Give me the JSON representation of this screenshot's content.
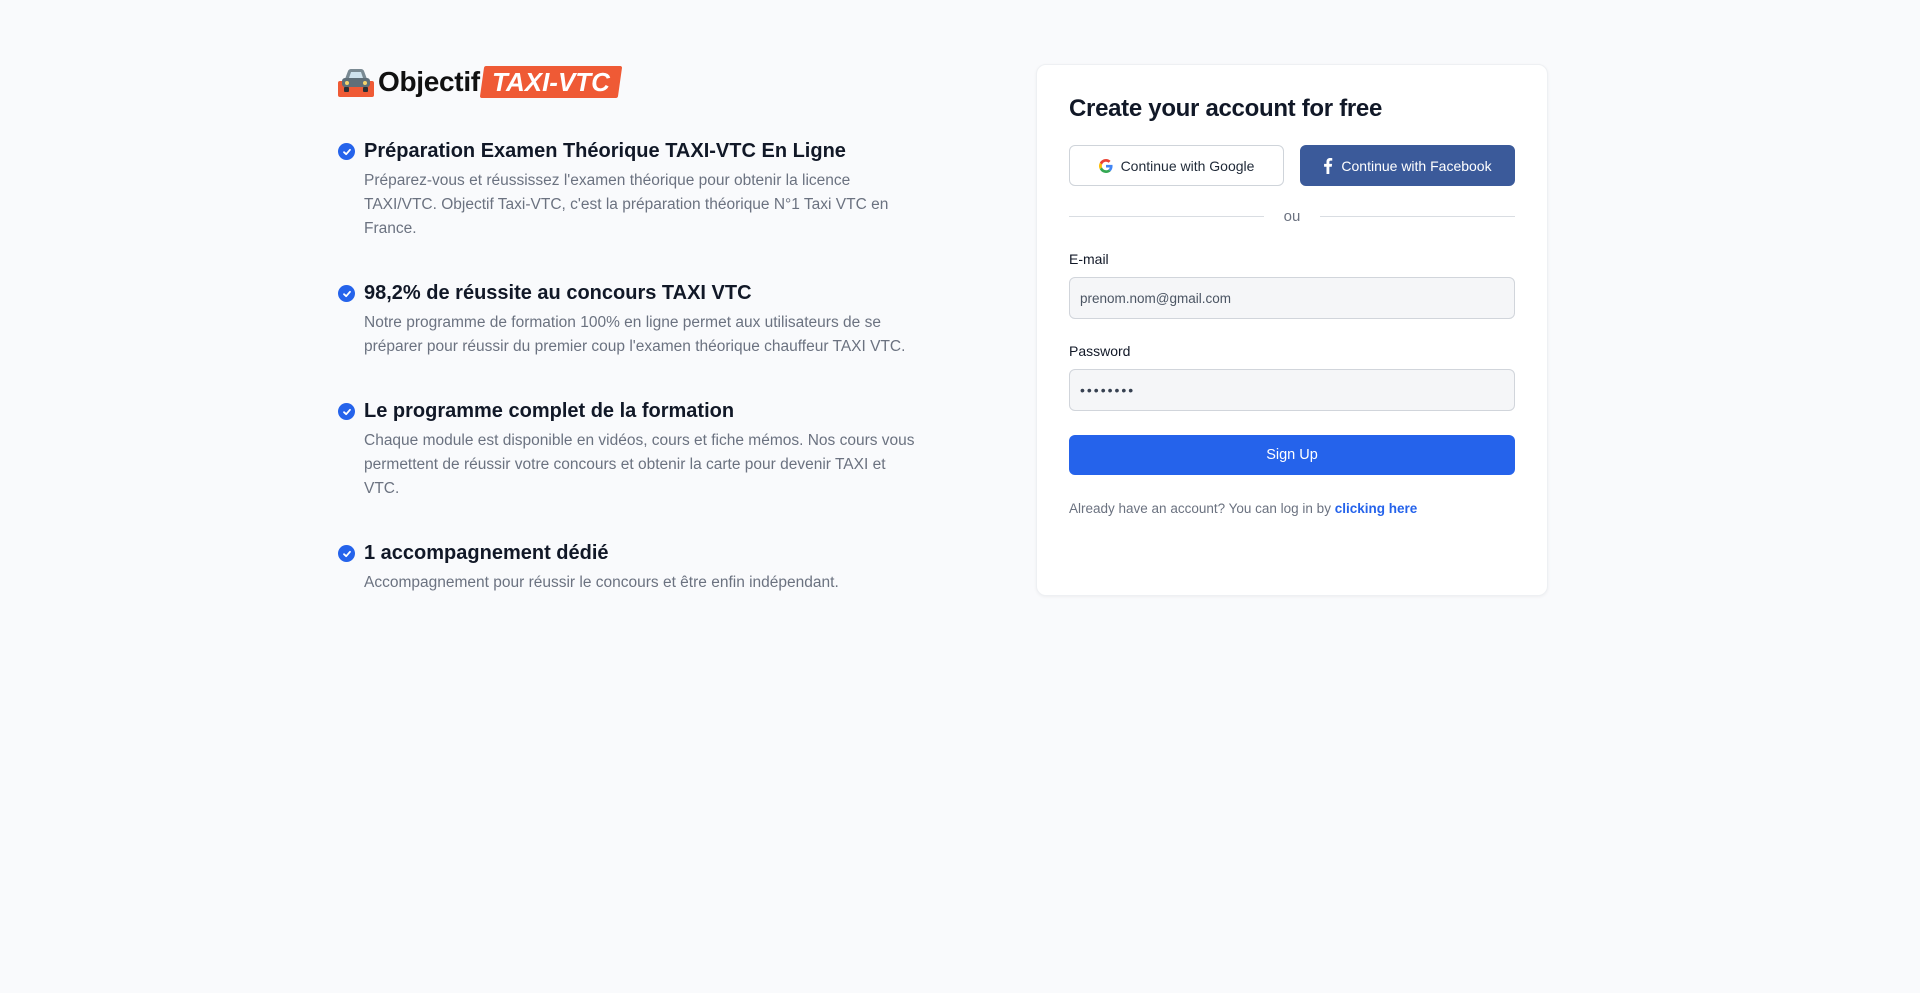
{
  "brand": {
    "name": "Objectif",
    "badge": "TAXI-VTC",
    "badge_color": "#ef5a35",
    "icon": "car-icon"
  },
  "features": [
    {
      "title": "Préparation Examen Théorique TAXI-VTC En Ligne",
      "description": "Préparez-vous et réussissez l'examen théorique pour obtenir la licence TAXI/VTC. Objectif Taxi-VTC, c'est la préparation théorique N°1 Taxi VTC en France."
    },
    {
      "title": "98,2% de réussite au concours TAXI VTC",
      "description": "Notre programme de formation 100% en ligne permet aux utilisateurs de se préparer pour réussir du premier coup l'examen théorique chauffeur TAXI VTC."
    },
    {
      "title": "Le programme complet de la formation",
      "description": "Chaque module est disponible en vidéos, cours et fiche mémos. Nos cours vous permettent de réussir votre concours et obtenir la carte pour devenir TAXI et VTC."
    },
    {
      "title": "1 accompagnement dédié",
      "description": "Accompagnement pour réussir le concours et être enfin indépendant."
    }
  ],
  "signup": {
    "title": "Create your account for free",
    "google_label": "Continue with Google",
    "facebook_label": "Continue with Facebook",
    "divider": "ou",
    "email_label": "E-mail",
    "email_placeholder": "prenom.nom@gmail.com",
    "password_label": "Password",
    "password_value": "••••••••",
    "submit_label": "Sign Up",
    "login_prompt": "Already have an account? You can log in by",
    "login_link": "clicking here"
  },
  "colors": {
    "accent": "#2563eb",
    "facebook": "#3b5a9a",
    "background": "#f9fafc"
  }
}
